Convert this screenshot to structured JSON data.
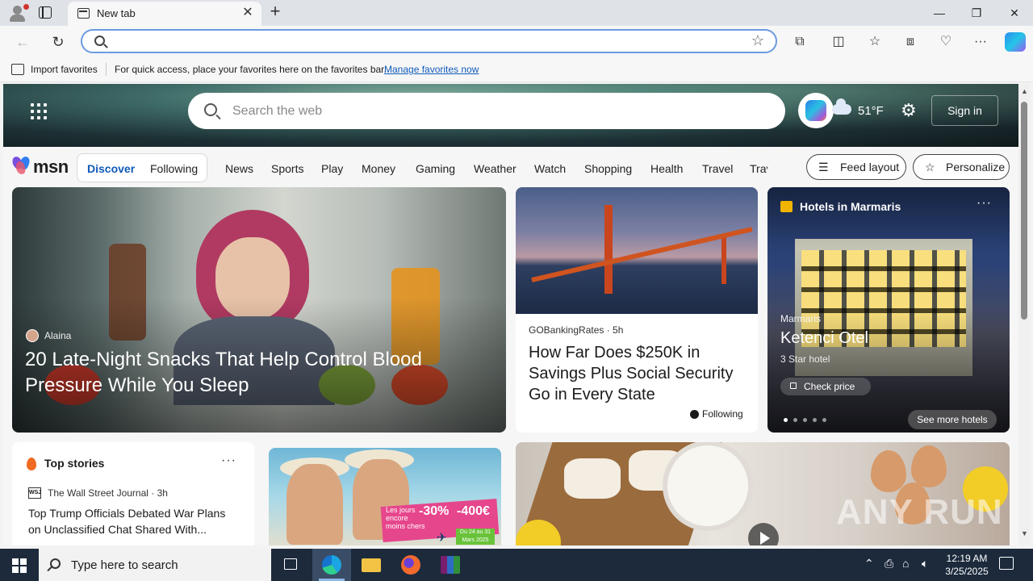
{
  "browser": {
    "tab_title": "New tab",
    "address_placeholder": "",
    "favorites_bar": {
      "import_label": "Import favorites",
      "message": "For quick access, place your favorites here on the favorites bar.",
      "manage_link": "Manage favorites now"
    }
  },
  "msn": {
    "search_placeholder": "Search the web",
    "temperature": "51°F",
    "sign_in": "Sign in",
    "logo_text": "msn",
    "segments": [
      "Discover",
      "Following"
    ],
    "categories": [
      "News",
      "Sports",
      "Play",
      "Money",
      "Gaming",
      "Weather",
      "Watch",
      "Shopping",
      "Health",
      "Travel",
      "Trav"
    ],
    "feed_layout": "Feed layout",
    "personalize": "Personalize"
  },
  "cards": {
    "lead": {
      "author": "Alaina",
      "title": "20 Late-Night Snacks That Help Control Blood Pressure While You Sleep"
    },
    "bridge": {
      "source": "GOBankingRates · 5h",
      "title": "How Far Does $250K in Savings Plus Social Security Go in Every State",
      "following": "Following"
    },
    "hotel": {
      "header": "Hotels in Marmaris",
      "city": "Marmaris",
      "name": "Ketenci Otel",
      "stars": "3 Star hotel",
      "check_price": "Check price",
      "see_more": "See more hotels"
    },
    "top_stories": {
      "header": "Top stories",
      "source_badge": "WSJ",
      "source": "The Wall Street Journal · 3h",
      "title": "Top Trump Officials Debated War Plans on Unclassified Chat Shared With..."
    },
    "ad": {
      "tagline": "Les jours encore moins chers",
      "discount_pct": "-30%",
      "discount_eur": "-400€",
      "dates": "Du 24 au 31 Mars 2025"
    }
  },
  "watermark": "ANY RUN",
  "taskbar": {
    "search_placeholder": "Type here to search",
    "time": "12:19 AM",
    "date": "3/25/2025"
  }
}
